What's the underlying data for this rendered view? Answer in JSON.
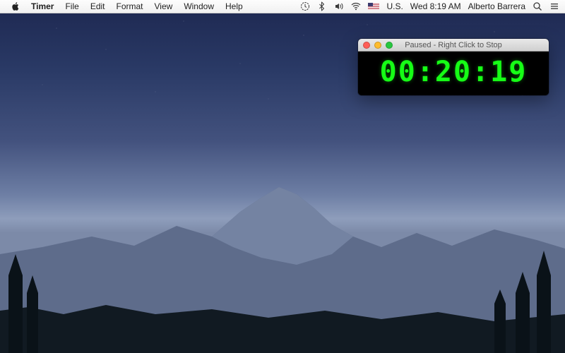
{
  "menubar": {
    "app_name": "Timer",
    "items": [
      "File",
      "Edit",
      "Format",
      "View",
      "Window",
      "Help"
    ],
    "status": {
      "input_label": "U.S.",
      "clock": "Wed 8:19 AM",
      "user": "Alberto Barrera"
    }
  },
  "timer_window": {
    "title": "Paused - Right Click to Stop",
    "time": "00:20:19",
    "time_color": "#16ff16"
  }
}
